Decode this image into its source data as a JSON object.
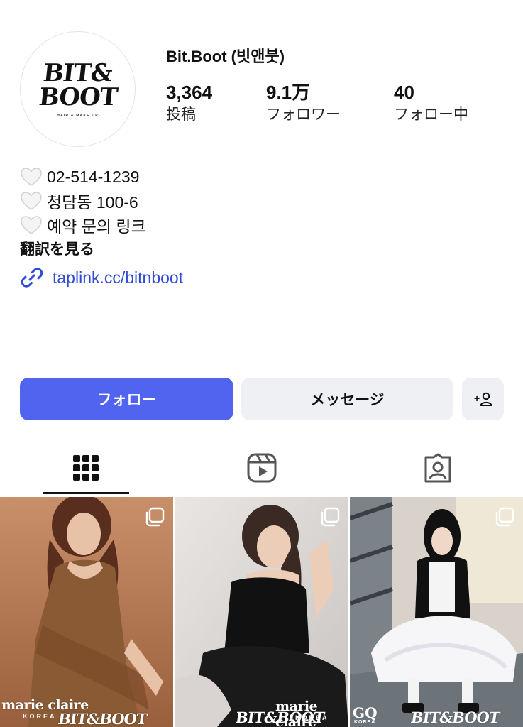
{
  "profile": {
    "avatar_logo_line1": "BIT&",
    "avatar_logo_line2": "BOOT",
    "avatar_logo_sub": "HAIR & MAKE UP",
    "name": "Bit.Boot (빗앤붓)"
  },
  "stats": [
    {
      "value": "3,364",
      "label": "投稿"
    },
    {
      "value": "9.1万",
      "label": "フォロワー"
    },
    {
      "value": "40",
      "label": "フォロー中"
    }
  ],
  "bio": {
    "lines": [
      {
        "icon": "white-heart-icon",
        "text": "02-514-1239"
      },
      {
        "icon": "white-heart-icon",
        "text": "청담동 100-6"
      },
      {
        "icon": "white-heart-icon",
        "text": "예약 문의 링크"
      }
    ],
    "translate_label": "翻訳を見る",
    "link_icon": "link-icon",
    "link_text": "taplink.cc/bitnboot"
  },
  "actions": {
    "follow_label": "フォロー",
    "message_label": "メッセージ",
    "add_user_label": "+"
  },
  "tabs": [
    {
      "name": "grid-icon",
      "selected": true
    },
    {
      "name": "reels-icon",
      "selected": false
    },
    {
      "name": "tagged-icon",
      "selected": false
    }
  ],
  "posts": [
    {
      "overlay_magazine": "marie claire",
      "overlay_magazine_sub": "KOREA",
      "overlay_brand": "BIT&BOOT",
      "icon": "multiple-posts-icon"
    },
    {
      "overlay_magazine": "marie claire",
      "overlay_magazine_sub": "KOREA",
      "overlay_brand": "BIT&BOOT",
      "icon": "multiple-posts-icon"
    },
    {
      "overlay_magazine": "GQ",
      "overlay_magazine_sub": "KOREA",
      "overlay_brand": "BIT&BOOT",
      "icon": "multiple-posts-icon"
    }
  ],
  "colors": {
    "accent": "#5064f0",
    "link": "#2f4bd6",
    "button_secondary": "#eff0f3"
  }
}
